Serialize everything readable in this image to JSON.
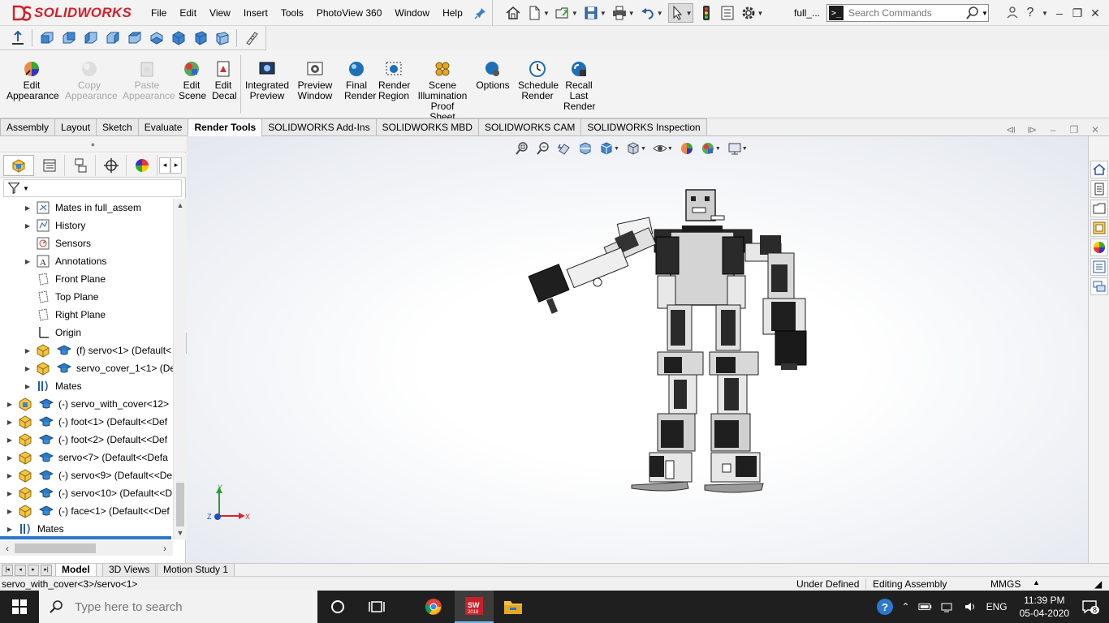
{
  "app": {
    "brand": "SOLIDWORKS",
    "doc_name": "full_..."
  },
  "menus": [
    "File",
    "Edit",
    "View",
    "Insert",
    "Tools",
    "PhotoView 360",
    "Window",
    "Help"
  ],
  "search": {
    "placeholder": "Search Commands",
    "value": ""
  },
  "window_controls": {
    "minimize": "–",
    "restore": "❐",
    "close": "✕"
  },
  "ribbon": [
    {
      "id": "edit-appearance",
      "label": [
        "Edit",
        "Appearance"
      ],
      "enabled": true,
      "icon": "edit-appearance-icon"
    },
    {
      "id": "copy-appearance",
      "label": [
        "Copy",
        "Appearance"
      ],
      "enabled": false,
      "icon": "copy-appearance-icon"
    },
    {
      "id": "paste-appearance",
      "label": [
        "Paste",
        "Appearance"
      ],
      "enabled": false,
      "icon": "paste-appearance-icon"
    },
    {
      "id": "edit-scene",
      "label": [
        "Edit",
        "Scene"
      ],
      "enabled": true,
      "icon": "edit-scene-icon"
    },
    {
      "id": "edit-decal",
      "label": [
        "Edit",
        "Decal"
      ],
      "enabled": true,
      "icon": "edit-decal-icon"
    },
    {
      "id": "integrated-preview",
      "label": [
        "Integrated",
        "Preview"
      ],
      "enabled": true,
      "icon": "integrated-preview-icon"
    },
    {
      "id": "preview-window",
      "label": [
        "Preview",
        "Window"
      ],
      "enabled": true,
      "icon": "preview-window-icon"
    },
    {
      "id": "final-render",
      "label": [
        "Final",
        "Render"
      ],
      "enabled": true,
      "icon": "final-render-icon"
    },
    {
      "id": "render-region",
      "label": [
        "Render",
        "Region"
      ],
      "enabled": true,
      "icon": "render-region-icon"
    },
    {
      "id": "scene-illumination",
      "label": [
        "Scene",
        "Illumination",
        "Proof Sheet"
      ],
      "enabled": true,
      "icon": "scene-illumination-icon"
    },
    {
      "id": "options",
      "label": [
        "Options"
      ],
      "enabled": true,
      "icon": "options-icon"
    },
    {
      "id": "schedule-render",
      "label": [
        "Schedule",
        "Render"
      ],
      "enabled": true,
      "icon": "schedule-render-icon"
    },
    {
      "id": "recall-last-render",
      "label": [
        "Recall",
        "Last",
        "Render"
      ],
      "enabled": true,
      "icon": "recall-last-render-icon"
    }
  ],
  "tabs": [
    {
      "label": "Assembly",
      "active": false
    },
    {
      "label": "Layout",
      "active": false
    },
    {
      "label": "Sketch",
      "active": false
    },
    {
      "label": "Evaluate",
      "active": false
    },
    {
      "label": "Render Tools",
      "active": true
    },
    {
      "label": "SOLIDWORKS Add-Ins",
      "active": false
    },
    {
      "label": "SOLIDWORKS MBD",
      "active": false
    },
    {
      "label": "SOLIDWORKS CAM",
      "active": false
    },
    {
      "label": "SOLIDWORKS Inspection",
      "active": false
    }
  ],
  "tree": [
    {
      "label": "Mates in full_assem",
      "icon": "mates-folder-icon",
      "expander": true,
      "indent": 1
    },
    {
      "label": "History",
      "icon": "history-icon",
      "expander": true,
      "indent": 1
    },
    {
      "label": "Sensors",
      "icon": "sensors-icon",
      "expander": false,
      "indent": 1
    },
    {
      "label": "Annotations",
      "icon": "annotations-icon",
      "expander": true,
      "indent": 1
    },
    {
      "label": "Front Plane",
      "icon": "plane-icon",
      "expander": false,
      "indent": 1
    },
    {
      "label": "Top Plane",
      "icon": "plane-icon",
      "expander": false,
      "indent": 1
    },
    {
      "label": "Right Plane",
      "icon": "plane-icon",
      "expander": false,
      "indent": 1
    },
    {
      "label": "Origin",
      "icon": "origin-icon",
      "expander": false,
      "indent": 1
    },
    {
      "label": "(f) servo<1> (Default<",
      "icon": "part-icon",
      "expander": true,
      "indent": 1,
      "cap": true
    },
    {
      "label": "servo_cover_1<1> (De",
      "icon": "part-icon",
      "expander": true,
      "indent": 1,
      "cap": true
    },
    {
      "label": "Mates",
      "icon": "mates-icon",
      "expander": true,
      "indent": 1
    },
    {
      "label": "(-) servo_with_cover<12>",
      "icon": "subassembly-icon",
      "expander": true,
      "indent": 0,
      "cap": true
    },
    {
      "label": "(-) foot<1> (Default<<Def",
      "icon": "part-icon",
      "expander": true,
      "indent": 0,
      "cap": true
    },
    {
      "label": "(-) foot<2> (Default<<Def",
      "icon": "part-icon",
      "expander": true,
      "indent": 0,
      "cap": true
    },
    {
      "label": "servo<7> (Default<<Defa",
      "icon": "part-icon",
      "expander": true,
      "indent": 0,
      "cap": true
    },
    {
      "label": "(-) servo<9> (Default<<De",
      "icon": "part-icon",
      "expander": true,
      "indent": 0,
      "cap": true
    },
    {
      "label": "(-) servo<10> (Default<<D",
      "icon": "part-icon",
      "expander": true,
      "indent": 0,
      "cap": true
    },
    {
      "label": "(-) face<1> (Default<<Def",
      "icon": "part-icon",
      "expander": true,
      "indent": 0,
      "cap": true
    },
    {
      "label": "Mates",
      "icon": "mates-icon",
      "expander": true,
      "indent": 0
    }
  ],
  "bottom_tabs": [
    {
      "label": "Model",
      "active": true
    },
    {
      "label": "3D Views",
      "active": false
    },
    {
      "label": "Motion Study 1",
      "active": false
    }
  ],
  "status": {
    "path": "servo_with_cover<3>/servo<1>",
    "state": "Under Defined",
    "mode": "Editing Assembly",
    "units": "MMGS"
  },
  "triad": {
    "y": "Y",
    "x": "X",
    "z": "Z"
  },
  "taskbar": {
    "search_placeholder": "Type here to search",
    "language": "ENG",
    "time": "11:39 PM",
    "date": "05-04-2020",
    "notifications": "8",
    "sw_badge": "2018"
  },
  "colors": {
    "accent": "#2b79c9",
    "brand": "#d4202a",
    "taskbar": "#1f1f1f"
  }
}
